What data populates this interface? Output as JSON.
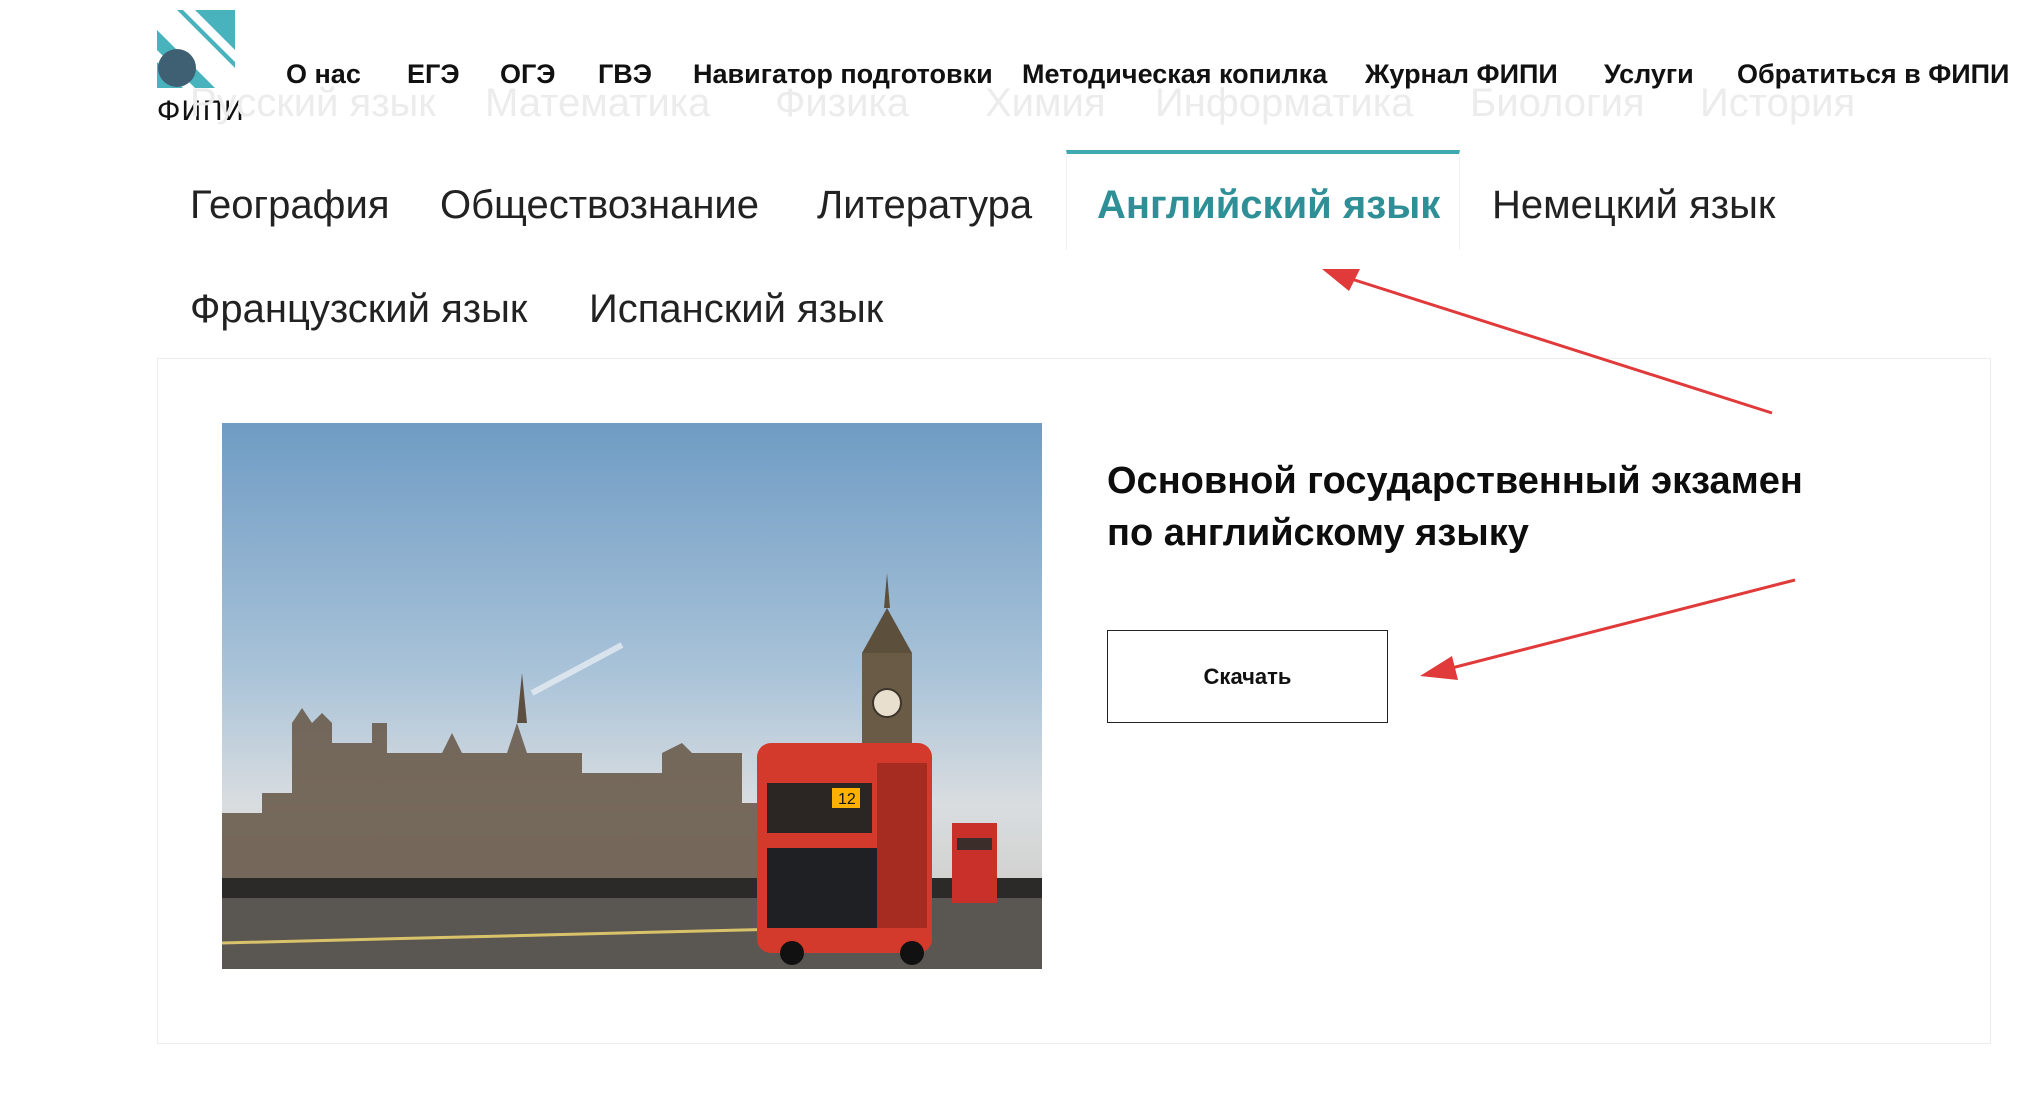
{
  "logo": {
    "text": "ФИПИ",
    "colors": {
      "teal": "#49b3bd",
      "dark": "#3f5f73"
    }
  },
  "topnav": [
    {
      "label": "О нас"
    },
    {
      "label": "ЕГЭ"
    },
    {
      "label": "ОГЭ"
    },
    {
      "label": "ГВЭ"
    },
    {
      "label": "Навигатор подготовки"
    },
    {
      "label": "Методическая копилка"
    },
    {
      "label": "Журнал ФИПИ"
    },
    {
      "label": "Услуги"
    },
    {
      "label": "Обратиться в ФИПИ"
    }
  ],
  "ghost_tabs": [
    "Русский язык",
    "Математика",
    "Физика",
    "Химия",
    "Информатика",
    "Биология",
    "История"
  ],
  "tabs": [
    {
      "label": "География"
    },
    {
      "label": "Обществознание"
    },
    {
      "label": "Литература"
    },
    {
      "label": "Английский язык",
      "active": true
    },
    {
      "label": "Немецкий язык"
    },
    {
      "label": "Французский язык"
    },
    {
      "label": "Испанский язык"
    }
  ],
  "content": {
    "title_line1": "Основной государственный экзамен",
    "title_line2": "по английскому языку",
    "download_label": "Скачать",
    "photo_bus_label": "12"
  },
  "colors": {
    "accent": "#3fa9b1",
    "active_tab_text": "#2e8f96",
    "arrow": "#e03a3a"
  }
}
